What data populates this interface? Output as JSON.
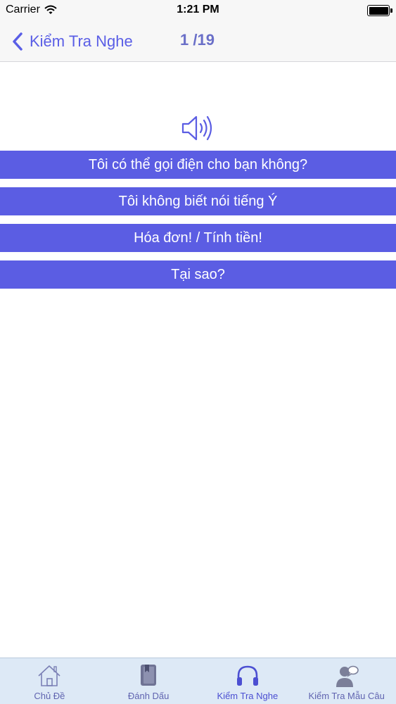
{
  "status_bar": {
    "carrier": "Carrier",
    "time": "1:21 PM"
  },
  "nav": {
    "back_label": "Kiểm Tra Nghe",
    "progress": "1 /19"
  },
  "answers": [
    "Tôi có thể gọi điện cho bạn không?",
    "Tôi không biết nói tiếng Ý",
    "Hóa đơn! / Tính tiền!",
    "Tại sao?"
  ],
  "tabs": [
    {
      "label": "Chủ Đề",
      "icon": "home-icon",
      "active": false
    },
    {
      "label": "Đánh Dấu",
      "icon": "bookmark-book-icon",
      "active": false
    },
    {
      "label": "Kiểm Tra Nghe",
      "icon": "headphones-icon",
      "active": true
    },
    {
      "label": "Kiểm Tra Mẫu Câu",
      "icon": "person-speech-icon",
      "active": false
    }
  ],
  "colors": {
    "accent": "#5b5de3",
    "nav_tint": "#5a5ee6",
    "tab_bar_bg": "#dde9f6"
  }
}
